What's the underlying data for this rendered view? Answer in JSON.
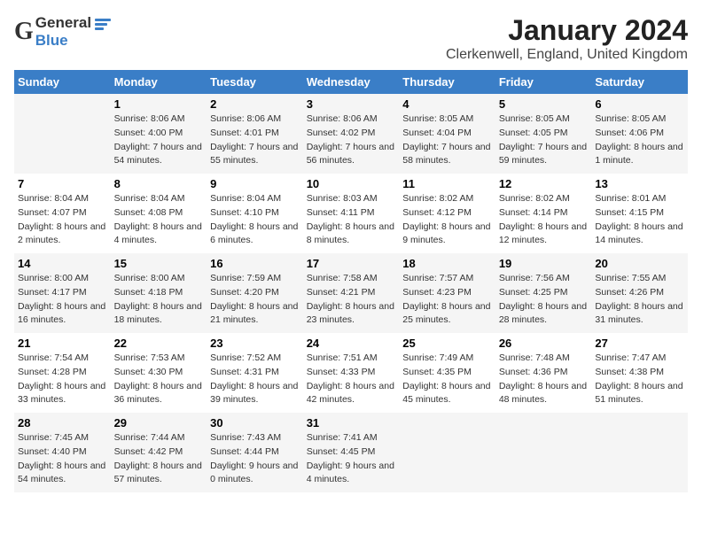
{
  "logo": {
    "general": "General",
    "blue": "Blue"
  },
  "title": "January 2024",
  "subtitle": "Clerkenwell, England, United Kingdom",
  "days_of_week": [
    "Sunday",
    "Monday",
    "Tuesday",
    "Wednesday",
    "Thursday",
    "Friday",
    "Saturday"
  ],
  "weeks": [
    [
      {
        "num": "",
        "sunrise": "",
        "sunset": "",
        "daylight": ""
      },
      {
        "num": "1",
        "sunrise": "Sunrise: 8:06 AM",
        "sunset": "Sunset: 4:00 PM",
        "daylight": "Daylight: 7 hours and 54 minutes."
      },
      {
        "num": "2",
        "sunrise": "Sunrise: 8:06 AM",
        "sunset": "Sunset: 4:01 PM",
        "daylight": "Daylight: 7 hours and 55 minutes."
      },
      {
        "num": "3",
        "sunrise": "Sunrise: 8:06 AM",
        "sunset": "Sunset: 4:02 PM",
        "daylight": "Daylight: 7 hours and 56 minutes."
      },
      {
        "num": "4",
        "sunrise": "Sunrise: 8:05 AM",
        "sunset": "Sunset: 4:04 PM",
        "daylight": "Daylight: 7 hours and 58 minutes."
      },
      {
        "num": "5",
        "sunrise": "Sunrise: 8:05 AM",
        "sunset": "Sunset: 4:05 PM",
        "daylight": "Daylight: 7 hours and 59 minutes."
      },
      {
        "num": "6",
        "sunrise": "Sunrise: 8:05 AM",
        "sunset": "Sunset: 4:06 PM",
        "daylight": "Daylight: 8 hours and 1 minute."
      }
    ],
    [
      {
        "num": "7",
        "sunrise": "Sunrise: 8:04 AM",
        "sunset": "Sunset: 4:07 PM",
        "daylight": "Daylight: 8 hours and 2 minutes."
      },
      {
        "num": "8",
        "sunrise": "Sunrise: 8:04 AM",
        "sunset": "Sunset: 4:08 PM",
        "daylight": "Daylight: 8 hours and 4 minutes."
      },
      {
        "num": "9",
        "sunrise": "Sunrise: 8:04 AM",
        "sunset": "Sunset: 4:10 PM",
        "daylight": "Daylight: 8 hours and 6 minutes."
      },
      {
        "num": "10",
        "sunrise": "Sunrise: 8:03 AM",
        "sunset": "Sunset: 4:11 PM",
        "daylight": "Daylight: 8 hours and 8 minutes."
      },
      {
        "num": "11",
        "sunrise": "Sunrise: 8:02 AM",
        "sunset": "Sunset: 4:12 PM",
        "daylight": "Daylight: 8 hours and 9 minutes."
      },
      {
        "num": "12",
        "sunrise": "Sunrise: 8:02 AM",
        "sunset": "Sunset: 4:14 PM",
        "daylight": "Daylight: 8 hours and 12 minutes."
      },
      {
        "num": "13",
        "sunrise": "Sunrise: 8:01 AM",
        "sunset": "Sunset: 4:15 PM",
        "daylight": "Daylight: 8 hours and 14 minutes."
      }
    ],
    [
      {
        "num": "14",
        "sunrise": "Sunrise: 8:00 AM",
        "sunset": "Sunset: 4:17 PM",
        "daylight": "Daylight: 8 hours and 16 minutes."
      },
      {
        "num": "15",
        "sunrise": "Sunrise: 8:00 AM",
        "sunset": "Sunset: 4:18 PM",
        "daylight": "Daylight: 8 hours and 18 minutes."
      },
      {
        "num": "16",
        "sunrise": "Sunrise: 7:59 AM",
        "sunset": "Sunset: 4:20 PM",
        "daylight": "Daylight: 8 hours and 21 minutes."
      },
      {
        "num": "17",
        "sunrise": "Sunrise: 7:58 AM",
        "sunset": "Sunset: 4:21 PM",
        "daylight": "Daylight: 8 hours and 23 minutes."
      },
      {
        "num": "18",
        "sunrise": "Sunrise: 7:57 AM",
        "sunset": "Sunset: 4:23 PM",
        "daylight": "Daylight: 8 hours and 25 minutes."
      },
      {
        "num": "19",
        "sunrise": "Sunrise: 7:56 AM",
        "sunset": "Sunset: 4:25 PM",
        "daylight": "Daylight: 8 hours and 28 minutes."
      },
      {
        "num": "20",
        "sunrise": "Sunrise: 7:55 AM",
        "sunset": "Sunset: 4:26 PM",
        "daylight": "Daylight: 8 hours and 31 minutes."
      }
    ],
    [
      {
        "num": "21",
        "sunrise": "Sunrise: 7:54 AM",
        "sunset": "Sunset: 4:28 PM",
        "daylight": "Daylight: 8 hours and 33 minutes."
      },
      {
        "num": "22",
        "sunrise": "Sunrise: 7:53 AM",
        "sunset": "Sunset: 4:30 PM",
        "daylight": "Daylight: 8 hours and 36 minutes."
      },
      {
        "num": "23",
        "sunrise": "Sunrise: 7:52 AM",
        "sunset": "Sunset: 4:31 PM",
        "daylight": "Daylight: 8 hours and 39 minutes."
      },
      {
        "num": "24",
        "sunrise": "Sunrise: 7:51 AM",
        "sunset": "Sunset: 4:33 PM",
        "daylight": "Daylight: 8 hours and 42 minutes."
      },
      {
        "num": "25",
        "sunrise": "Sunrise: 7:49 AM",
        "sunset": "Sunset: 4:35 PM",
        "daylight": "Daylight: 8 hours and 45 minutes."
      },
      {
        "num": "26",
        "sunrise": "Sunrise: 7:48 AM",
        "sunset": "Sunset: 4:36 PM",
        "daylight": "Daylight: 8 hours and 48 minutes."
      },
      {
        "num": "27",
        "sunrise": "Sunrise: 7:47 AM",
        "sunset": "Sunset: 4:38 PM",
        "daylight": "Daylight: 8 hours and 51 minutes."
      }
    ],
    [
      {
        "num": "28",
        "sunrise": "Sunrise: 7:45 AM",
        "sunset": "Sunset: 4:40 PM",
        "daylight": "Daylight: 8 hours and 54 minutes."
      },
      {
        "num": "29",
        "sunrise": "Sunrise: 7:44 AM",
        "sunset": "Sunset: 4:42 PM",
        "daylight": "Daylight: 8 hours and 57 minutes."
      },
      {
        "num": "30",
        "sunrise": "Sunrise: 7:43 AM",
        "sunset": "Sunset: 4:44 PM",
        "daylight": "Daylight: 9 hours and 0 minutes."
      },
      {
        "num": "31",
        "sunrise": "Sunrise: 7:41 AM",
        "sunset": "Sunset: 4:45 PM",
        "daylight": "Daylight: 9 hours and 4 minutes."
      },
      {
        "num": "",
        "sunrise": "",
        "sunset": "",
        "daylight": ""
      },
      {
        "num": "",
        "sunrise": "",
        "sunset": "",
        "daylight": ""
      },
      {
        "num": "",
        "sunrise": "",
        "sunset": "",
        "daylight": ""
      }
    ]
  ]
}
